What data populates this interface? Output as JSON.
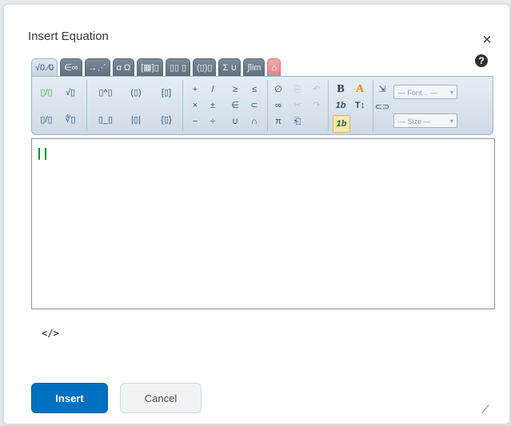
{
  "dialog": {
    "title": "Insert Equation",
    "close_symbol": "×",
    "help_symbol": "?"
  },
  "tabs": [
    {
      "label": "√0 ⁄0",
      "active": true
    },
    {
      "label": "∈∞"
    },
    {
      "label": "→⋰"
    },
    {
      "label": "α Ω"
    },
    {
      "label": "[▦]▯"
    },
    {
      "label": "▯▯ ▯"
    },
    {
      "label": "(▯)▯"
    },
    {
      "label": "Σ ∪"
    },
    {
      "label": "∫lim"
    },
    {
      "label": "⌂",
      "red": true
    }
  ],
  "toolbar": {
    "fraction": [
      "▯/▯",
      "√▯",
      "▯/▯",
      "∜▯"
    ],
    "scripts": [
      "▯^▯",
      "(▯)",
      "[▯]",
      "▯_▯",
      "|▯|",
      "{▯}"
    ],
    "operators": [
      "+",
      "/",
      "≥",
      "≤",
      "×",
      "±",
      "∈",
      "⊂",
      "−",
      "÷",
      "∪",
      "∩"
    ],
    "misc": [
      "∅",
      "∞",
      "π"
    ],
    "format": {
      "bold": "B",
      "font_color": "A",
      "italic": "1b",
      "size": "T↕",
      "sample": "1b"
    },
    "font_placeholder": "— Font... —",
    "size_placeholder": "— Size —"
  },
  "editor": {
    "value": ""
  },
  "source_toggle": "</>",
  "buttons": {
    "insert": "Insert",
    "cancel": "Cancel"
  },
  "colors": {
    "primary": "#006fbf",
    "toolbar": "#dfe8f1",
    "caret": "#1d8a34"
  }
}
